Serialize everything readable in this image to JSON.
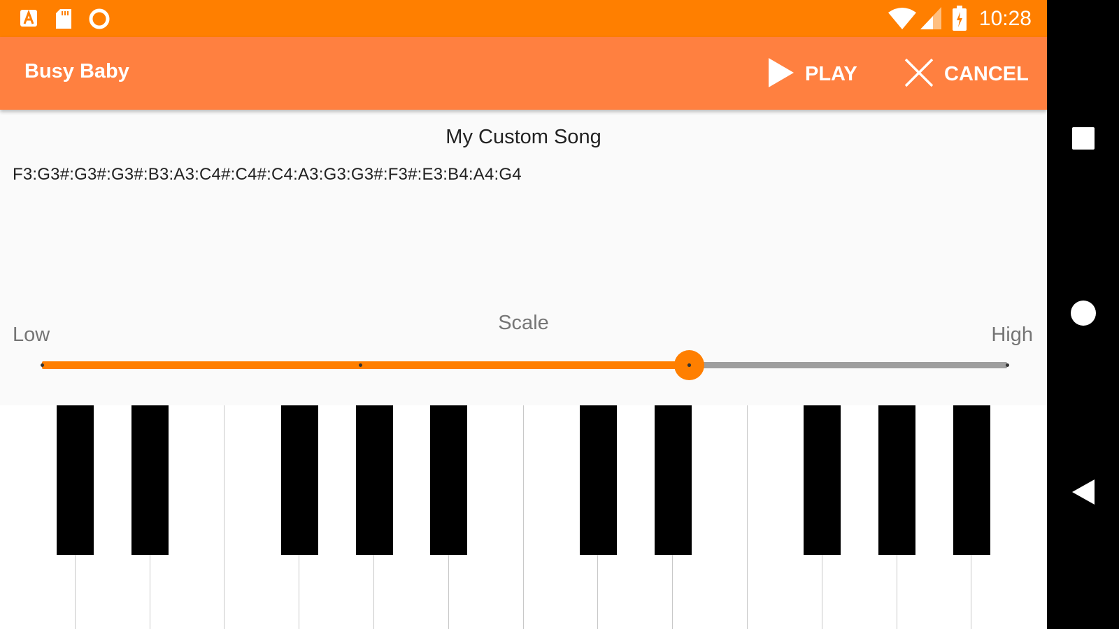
{
  "status_bar": {
    "time": "10:28",
    "icons": [
      "a-notification-icon",
      "sd-card-icon",
      "circle-notification-icon",
      "wifi-icon",
      "cell-signal-icon",
      "battery-icon"
    ]
  },
  "toolbar": {
    "title": "Busy Baby",
    "play_label": "PLAY",
    "cancel_label": "CANCEL"
  },
  "song": {
    "title": "My Custom Song",
    "notes": "F3:G3#:G3#:G3#:B3:A3:C4#:C4#:C4:A3:G3:G3#:F3#:E3:B4:A4:G4"
  },
  "scale": {
    "label": "Scale",
    "low_label": "Low",
    "high_label": "High",
    "value": 0.67,
    "ticks": [
      0,
      0.33,
      0.67,
      1
    ]
  },
  "keyboard": {
    "white_key_count": 14,
    "black_key_after_white": [
      0,
      1,
      3,
      4,
      5,
      7,
      8,
      10,
      11,
      12
    ]
  },
  "colors": {
    "accent": "#ff7f00",
    "toolbar": "#ff8040",
    "status_bar": "#ff7f00"
  },
  "nav": [
    "recents-square-icon",
    "home-circle-icon",
    "back-triangle-icon"
  ]
}
